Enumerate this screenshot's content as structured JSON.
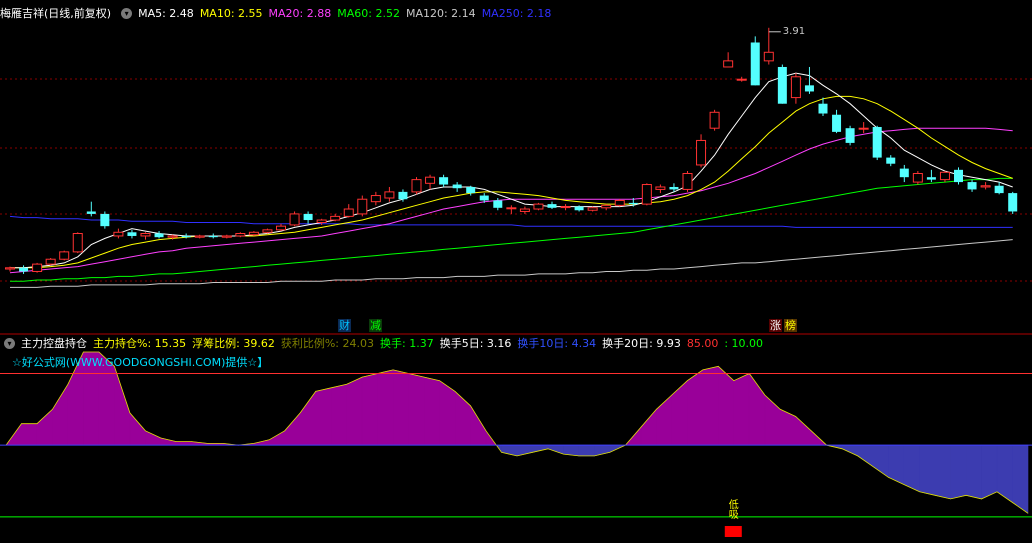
{
  "top_panel": {
    "stock_name": "梅雁吉祥",
    "period": "(日线,前复权)",
    "ma_labels": [
      {
        "text": "MA5: 2.48",
        "color": "#ffffff"
      },
      {
        "text": "MA10: 2.55",
        "color": "#ffff00"
      },
      {
        "text": "MA20: 2.88",
        "color": "#ff40ff"
      },
      {
        "text": "MA60: 2.52",
        "color": "#00ff00"
      },
      {
        "text": "MA120: 2.14",
        "color": "#c8c8c8"
      },
      {
        "text": "MA250: 2.18",
        "color": "#3030ff"
      }
    ],
    "peak_label": "3.91",
    "badges": [
      {
        "text": "财",
        "color": "#00c0ff",
        "bg": "#0a2a55"
      },
      {
        "text": "减",
        "color": "#00ff00",
        "bg": "#0a3a0a"
      },
      {
        "text": "涨",
        "color": "#ffffff",
        "bg": "#550000"
      },
      {
        "text": "榜",
        "color": "#ffff00",
        "bg": "#553300"
      }
    ]
  },
  "bottom_panel": {
    "indicator_name": "主力控盘持仓",
    "stats": [
      {
        "text": "主力持仓%: 15.35",
        "color": "#ffff00"
      },
      {
        "text": "浮筹比例: 39.62",
        "color": "#ffff00"
      },
      {
        "text": "获利比例%: 24.03",
        "color": "#808000"
      },
      {
        "text": "换手: 1.37",
        "color": "#00ff00"
      },
      {
        "text": "换手5日: 3.16",
        "color": "#ffffff"
      },
      {
        "text": "换手10日: 4.34",
        "color": "#3050ff"
      },
      {
        "text": "换手20日: 9.93",
        "color": "#ffffff"
      },
      {
        "text": "85.00",
        "color": "#ff3030"
      },
      {
        "text": ": 10.00",
        "color": "#00ff00"
      }
    ],
    "promo": "☆好公式网(WWW.GOODGONGSHI.COM)提供☆】",
    "signal_text": "低吸"
  },
  "colors": {
    "up": "#ff3232",
    "down": "#54ffff",
    "grid": "#8a0000",
    "ma5": "#ffffff",
    "ma10": "#ffff00",
    "ma20": "#ff40ff",
    "ma60": "#00ff00",
    "ma120": "#c8c8c8",
    "ma250": "#3030ff",
    "fill_pos": "#990099",
    "fill_neg": "#3c3cb0"
  },
  "chart_data": [
    {
      "type": "candlestick",
      "ylim": [
        1.55,
        4.0
      ],
      "candles": [
        [
          1.95,
          1.97,
          1.93,
          1.96
        ],
        [
          1.96,
          1.98,
          1.91,
          1.93
        ],
        [
          1.93,
          2.0,
          1.92,
          1.99
        ],
        [
          1.99,
          2.04,
          1.98,
          2.03
        ],
        [
          2.03,
          2.1,
          2.02,
          2.09
        ],
        [
          2.09,
          2.25,
          2.08,
          2.24
        ],
        [
          2.42,
          2.5,
          2.38,
          2.4
        ],
        [
          2.4,
          2.42,
          2.28,
          2.3
        ],
        [
          2.22,
          2.28,
          2.2,
          2.25
        ],
        [
          2.25,
          2.27,
          2.2,
          2.22
        ],
        [
          2.22,
          2.25,
          2.19,
          2.24
        ],
        [
          2.24,
          2.26,
          2.2,
          2.21
        ],
        [
          2.21,
          2.23,
          2.19,
          2.22
        ],
        [
          2.22,
          2.24,
          2.2,
          2.21
        ],
        [
          2.21,
          2.23,
          2.2,
          2.22
        ],
        [
          2.22,
          2.24,
          2.2,
          2.21
        ],
        [
          2.21,
          2.23,
          2.2,
          2.22
        ],
        [
          2.22,
          2.25,
          2.21,
          2.24
        ],
        [
          2.23,
          2.26,
          2.22,
          2.25
        ],
        [
          2.25,
          2.28,
          2.24,
          2.27
        ],
        [
          2.27,
          2.32,
          2.26,
          2.3
        ],
        [
          2.31,
          2.42,
          2.3,
          2.4
        ],
        [
          2.4,
          2.42,
          2.32,
          2.35
        ],
        [
          2.33,
          2.36,
          2.31,
          2.35
        ],
        [
          2.35,
          2.4,
          2.34,
          2.38
        ],
        [
          2.38,
          2.48,
          2.37,
          2.44
        ],
        [
          2.4,
          2.55,
          2.38,
          2.52
        ],
        [
          2.5,
          2.58,
          2.47,
          2.55
        ],
        [
          2.53,
          2.62,
          2.5,
          2.58
        ],
        [
          2.58,
          2.6,
          2.5,
          2.52
        ],
        [
          2.58,
          2.7,
          2.56,
          2.68
        ],
        [
          2.65,
          2.72,
          2.6,
          2.7
        ],
        [
          2.7,
          2.72,
          2.62,
          2.64
        ],
        [
          2.64,
          2.66,
          2.58,
          2.61
        ],
        [
          2.62,
          2.63,
          2.55,
          2.57
        ],
        [
          2.55,
          2.57,
          2.49,
          2.51
        ],
        [
          2.51,
          2.53,
          2.43,
          2.45
        ],
        [
          2.45,
          2.47,
          2.4,
          2.45
        ],
        [
          2.42,
          2.46,
          2.4,
          2.44
        ],
        [
          2.44,
          2.49,
          2.43,
          2.48
        ],
        [
          2.48,
          2.5,
          2.44,
          2.45
        ],
        [
          2.46,
          2.48,
          2.43,
          2.46
        ],
        [
          2.46,
          2.47,
          2.42,
          2.43
        ],
        [
          2.43,
          2.46,
          2.42,
          2.45
        ],
        [
          2.45,
          2.48,
          2.43,
          2.47
        ],
        [
          2.47,
          2.52,
          2.46,
          2.51
        ],
        [
          2.49,
          2.53,
          2.46,
          2.48
        ],
        [
          2.48,
          2.65,
          2.47,
          2.64
        ],
        [
          2.6,
          2.64,
          2.57,
          2.62
        ],
        [
          2.62,
          2.65,
          2.58,
          2.6
        ],
        [
          2.6,
          2.75,
          2.58,
          2.73
        ],
        [
          2.8,
          3.05,
          2.78,
          3.0
        ],
        [
          3.1,
          3.25,
          3.08,
          3.23
        ],
        [
          3.6,
          3.72,
          3.6,
          3.65
        ],
        [
          3.5,
          3.52,
          3.48,
          3.5
        ],
        [
          3.8,
          3.85,
          3.45,
          3.45
        ],
        [
          3.65,
          3.92,
          3.62,
          3.72
        ],
        [
          3.6,
          3.62,
          3.3,
          3.3
        ],
        [
          3.35,
          3.55,
          3.3,
          3.52
        ],
        [
          3.45,
          3.6,
          3.38,
          3.4
        ],
        [
          3.3,
          3.35,
          3.2,
          3.22
        ],
        [
          3.21,
          3.25,
          3.06,
          3.07
        ],
        [
          3.1,
          3.12,
          2.96,
          2.98
        ],
        [
          3.1,
          3.15,
          3.06,
          3.1
        ],
        [
          3.11,
          3.12,
          2.84,
          2.86
        ],
        [
          2.86,
          2.88,
          2.79,
          2.81
        ],
        [
          2.77,
          2.8,
          2.66,
          2.7
        ],
        [
          2.66,
          2.75,
          2.64,
          2.73
        ],
        [
          2.7,
          2.76,
          2.66,
          2.68
        ],
        [
          2.68,
          2.75,
          2.66,
          2.74
        ],
        [
          2.76,
          2.78,
          2.64,
          2.66
        ],
        [
          2.66,
          2.68,
          2.58,
          2.6
        ],
        [
          2.62,
          2.66,
          2.6,
          2.63
        ],
        [
          2.63,
          2.66,
          2.56,
          2.57
        ],
        [
          2.57,
          2.58,
          2.4,
          2.42
        ]
      ],
      "ma5": [
        1.96,
        1.96,
        1.97,
        1.98,
        2.0,
        2.05,
        2.15,
        2.2,
        2.24,
        2.28,
        2.26,
        2.24,
        2.23,
        2.22,
        2.22,
        2.22,
        2.22,
        2.22,
        2.23,
        2.24,
        2.26,
        2.29,
        2.31,
        2.33,
        2.35,
        2.38,
        2.41,
        2.45,
        2.49,
        2.52,
        2.56,
        2.6,
        2.62,
        2.62,
        2.62,
        2.6,
        2.56,
        2.52,
        2.48,
        2.47,
        2.46,
        2.46,
        2.46,
        2.46,
        2.46,
        2.46,
        2.47,
        2.5,
        2.54,
        2.58,
        2.63,
        2.75,
        2.88,
        3.05,
        3.2,
        3.35,
        3.48,
        3.52,
        3.55,
        3.53,
        3.45,
        3.38,
        3.3,
        3.2,
        3.1,
        3.02,
        2.92,
        2.86,
        2.8,
        2.75,
        2.72,
        2.7,
        2.68,
        2.66,
        2.62
      ],
      "ma10": [
        1.96,
        1.96,
        1.96,
        1.97,
        1.98,
        2.0,
        2.04,
        2.08,
        2.12,
        2.15,
        2.17,
        2.19,
        2.2,
        2.21,
        2.22,
        2.22,
        2.22,
        2.22,
        2.22,
        2.23,
        2.24,
        2.25,
        2.27,
        2.29,
        2.31,
        2.33,
        2.35,
        2.38,
        2.41,
        2.44,
        2.47,
        2.5,
        2.53,
        2.55,
        2.57,
        2.58,
        2.58,
        2.57,
        2.56,
        2.55,
        2.53,
        2.51,
        2.5,
        2.49,
        2.48,
        2.48,
        2.48,
        2.49,
        2.5,
        2.52,
        2.55,
        2.6,
        2.66,
        2.75,
        2.85,
        2.95,
        3.06,
        3.15,
        3.24,
        3.3,
        3.34,
        3.36,
        3.36,
        3.34,
        3.3,
        3.24,
        3.17,
        3.1,
        3.02,
        2.95,
        2.88,
        2.82,
        2.77,
        2.73,
        2.69
      ],
      "ma20": [
        1.92,
        1.93,
        1.94,
        1.95,
        1.96,
        1.97,
        1.99,
        2.01,
        2.03,
        2.05,
        2.07,
        2.09,
        2.1,
        2.12,
        2.13,
        2.14,
        2.15,
        2.16,
        2.17,
        2.18,
        2.19,
        2.2,
        2.21,
        2.22,
        2.24,
        2.26,
        2.28,
        2.3,
        2.32,
        2.35,
        2.38,
        2.41,
        2.44,
        2.46,
        2.48,
        2.5,
        2.51,
        2.52,
        2.52,
        2.52,
        2.52,
        2.52,
        2.52,
        2.52,
        2.52,
        2.52,
        2.52,
        2.53,
        2.54,
        2.55,
        2.57,
        2.59,
        2.62,
        2.65,
        2.69,
        2.73,
        2.78,
        2.83,
        2.88,
        2.93,
        2.97,
        3.0,
        3.03,
        3.05,
        3.07,
        3.08,
        3.09,
        3.1,
        3.1,
        3.1,
        3.1,
        3.1,
        3.1,
        3.09,
        3.08
      ],
      "ma60": [
        1.85,
        1.85,
        1.86,
        1.86,
        1.87,
        1.87,
        1.88,
        1.88,
        1.89,
        1.89,
        1.9,
        1.91,
        1.91,
        1.92,
        1.93,
        1.94,
        1.95,
        1.96,
        1.97,
        1.98,
        1.99,
        2.0,
        2.01,
        2.02,
        2.03,
        2.04,
        2.05,
        2.06,
        2.07,
        2.08,
        2.09,
        2.1,
        2.11,
        2.12,
        2.13,
        2.14,
        2.15,
        2.16,
        2.17,
        2.18,
        2.19,
        2.2,
        2.21,
        2.22,
        2.23,
        2.24,
        2.25,
        2.27,
        2.29,
        2.31,
        2.33,
        2.35,
        2.37,
        2.39,
        2.41,
        2.43,
        2.45,
        2.47,
        2.49,
        2.51,
        2.53,
        2.55,
        2.57,
        2.59,
        2.61,
        2.62,
        2.63,
        2.64,
        2.65,
        2.66,
        2.67,
        2.68,
        2.68,
        2.69,
        2.69
      ],
      "ma120": [
        1.8,
        1.8,
        1.8,
        1.81,
        1.81,
        1.81,
        1.82,
        1.82,
        1.82,
        1.82,
        1.82,
        1.83,
        1.83,
        1.83,
        1.83,
        1.84,
        1.84,
        1.84,
        1.84,
        1.84,
        1.85,
        1.85,
        1.85,
        1.85,
        1.86,
        1.86,
        1.86,
        1.87,
        1.87,
        1.87,
        1.88,
        1.88,
        1.88,
        1.89,
        1.89,
        1.89,
        1.9,
        1.9,
        1.9,
        1.91,
        1.91,
        1.91,
        1.92,
        1.92,
        1.93,
        1.93,
        1.94,
        1.94,
        1.95,
        1.95,
        1.96,
        1.97,
        1.98,
        1.99,
        2.0,
        2.0,
        2.01,
        2.02,
        2.03,
        2.04,
        2.05,
        2.06,
        2.07,
        2.08,
        2.09,
        2.1,
        2.11,
        2.12,
        2.13,
        2.14,
        2.15,
        2.16,
        2.17,
        2.18,
        2.19
      ],
      "ma250": [
        2.38,
        2.37,
        2.37,
        2.36,
        2.36,
        2.36,
        2.35,
        2.35,
        2.35,
        2.34,
        2.34,
        2.34,
        2.34,
        2.33,
        2.33,
        2.33,
        2.33,
        2.33,
        2.32,
        2.32,
        2.32,
        2.32,
        2.32,
        2.32,
        2.32,
        2.32,
        2.31,
        2.31,
        2.31,
        2.31,
        2.31,
        2.31,
        2.31,
        2.31,
        2.31,
        2.31,
        2.31,
        2.31,
        2.3,
        2.3,
        2.3,
        2.3,
        2.3,
        2.3,
        2.3,
        2.3,
        2.3,
        2.3,
        2.3,
        2.3,
        2.3,
        2.3,
        2.3,
        2.3,
        2.3,
        2.3,
        2.3,
        2.3,
        2.29,
        2.29,
        2.29,
        2.29,
        2.29,
        2.29,
        2.29,
        2.29,
        2.29,
        2.29,
        2.29,
        2.29,
        2.29,
        2.29,
        2.29,
        2.29,
        2.29
      ]
    },
    {
      "type": "area",
      "ylim": [
        -22,
        26
      ],
      "reference_lines": [
        20,
        0,
        -20
      ],
      "values": [
        0,
        6,
        6,
        10,
        17,
        26,
        26,
        22,
        9,
        4,
        2,
        1,
        1,
        0.5,
        0.5,
        0,
        0.5,
        1.5,
        4,
        9,
        15,
        16,
        17,
        19,
        20,
        21,
        20,
        19,
        18,
        15,
        11,
        4,
        -2,
        -3,
        -2,
        -1,
        -2.5,
        -3,
        -3,
        -2,
        0,
        5,
        10,
        14,
        18,
        21,
        22,
        18,
        20,
        14,
        10,
        8,
        4,
        0,
        -1,
        -3,
        -6,
        -9,
        -11,
        -13,
        -14,
        -15,
        -14,
        -15,
        -13,
        -16,
        -19
      ],
      "signal_index": 47
    }
  ]
}
